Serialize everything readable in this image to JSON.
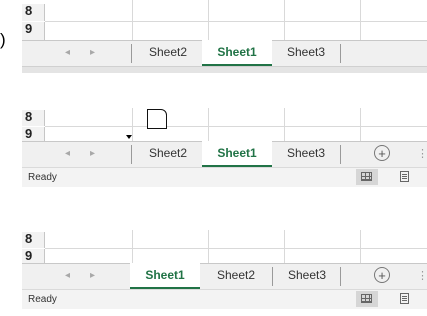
{
  "label_marker": ")",
  "panels": [
    {
      "rows": [
        "8",
        "9"
      ],
      "tabs": [
        {
          "label": "Sheet2",
          "active": false
        },
        {
          "label": "Sheet1",
          "active": true
        },
        {
          "label": "Sheet3",
          "active": false
        }
      ],
      "nav_prev": "◂",
      "nav_next": "▸",
      "status_text": ""
    },
    {
      "rows": [
        "8",
        "9"
      ],
      "tabs": [
        {
          "label": "Sheet2",
          "active": false
        },
        {
          "label": "Sheet1",
          "active": true
        },
        {
          "label": "Sheet3",
          "active": false
        }
      ],
      "nav_prev": "◂",
      "nav_next": "▸",
      "add_sheet": "+",
      "more": "⋮",
      "status_text": "Ready"
    },
    {
      "rows": [
        "8",
        "9"
      ],
      "tabs": [
        {
          "label": "Sheet1",
          "active": true
        },
        {
          "label": "Sheet2",
          "active": false
        },
        {
          "label": "Sheet3",
          "active": false
        }
      ],
      "nav_prev": "◂",
      "nav_next": "▸",
      "add_sheet": "+",
      "more": "⋮",
      "status_text": "Ready"
    }
  ],
  "colors": {
    "active_tab": "#217346",
    "tabbar_bg": "#f0f0f0",
    "status_bg": "#f3f3f3"
  }
}
